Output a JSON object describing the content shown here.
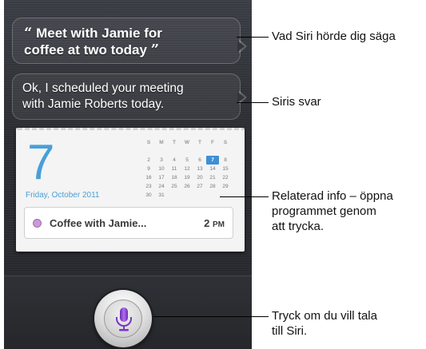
{
  "siri": {
    "said_line1": "Meet with Jamie for",
    "said_line2": "coffee at two today",
    "open_quote": "“",
    "close_quote": "”",
    "reply_line1": "Ok, I scheduled your meeting",
    "reply_line2": "with Jamie Roberts today."
  },
  "calendar": {
    "day": "7",
    "date_label": "Friday, October 2011",
    "weekdays": [
      "S",
      "M",
      "T",
      "W",
      "T",
      "F",
      "S"
    ],
    "weeks": [
      [
        "",
        "",
        "",
        "",
        "",
        "",
        ""
      ],
      [
        "2",
        "3",
        "4",
        "5",
        "6",
        "7",
        "8"
      ],
      [
        "9",
        "10",
        "11",
        "12",
        "13",
        "14",
        "15"
      ],
      [
        "16",
        "17",
        "18",
        "19",
        "20",
        "21",
        "22"
      ],
      [
        "23",
        "24",
        "25",
        "26",
        "27",
        "28",
        "29"
      ],
      [
        "30",
        "31",
        "",
        "",
        "",
        "",
        ""
      ]
    ],
    "selected_day": "7",
    "event_title": "Coffee with Jamie...",
    "event_time": "2",
    "event_ampm": "PM"
  },
  "callouts": {
    "said": "Vad Siri hörde dig säga",
    "reply": "Siris svar",
    "info_line1": "Relaterad info – öppna",
    "info_line2": "programmet genom",
    "info_line3": "att trycka.",
    "mic_line1": "Tryck om du vill tala",
    "mic_line2": "till Siri."
  },
  "colors": {
    "accent": "#4a9fd8",
    "event_dot": "#c99bd6",
    "mic": "#8a3fd0"
  },
  "icons": {
    "mic": "microphone-icon"
  }
}
